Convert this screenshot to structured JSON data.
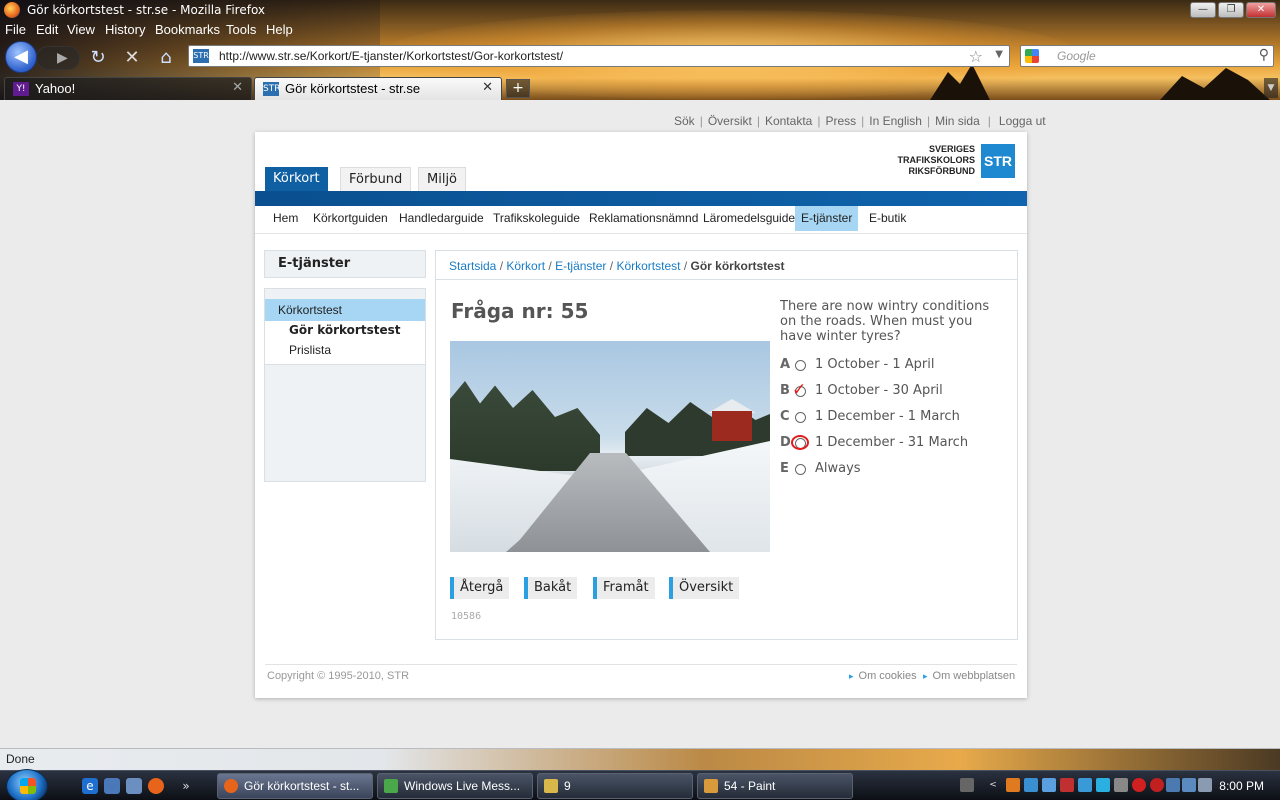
{
  "window": {
    "title": "Gör körkortstest - str.se - Mozilla Firefox",
    "controls": {
      "minimize": "—",
      "maximize": "❐",
      "close": "✕"
    }
  },
  "menu": [
    "File",
    "Edit",
    "View",
    "History",
    "Bookmarks",
    "Tools",
    "Help"
  ],
  "navbar": {
    "url": "http://www.str.se/Korkort/E-tjanster/Korkortstest/Gor-korkortstest/",
    "search_placeholder": "Google",
    "icons": {
      "back": "◀",
      "forward": "▶",
      "reload": "↻",
      "stop": "✕",
      "home": "⌂",
      "bookmark_star": "☆",
      "search_go": "⚲"
    }
  },
  "tabs": [
    {
      "label": "Yahoo!",
      "active": false,
      "favicon": "Y!",
      "color": "#5f1b8f"
    },
    {
      "label": "Gör körkortstest - str.se",
      "active": true,
      "favicon": "STR",
      "color": "#2b6fb0"
    }
  ],
  "site": {
    "utility_links": [
      "Sök",
      "Översikt",
      "Kontakta",
      "Press",
      "In English",
      "Min sida",
      "Logga ut"
    ],
    "logo": {
      "lines": [
        "SVERIGES",
        "TRAFIKSKOLORS",
        "RIKSFÖRBUND"
      ],
      "mark": "STR"
    },
    "main_tabs": [
      {
        "label": "Körkort",
        "active": true
      },
      {
        "label": "Förbund",
        "active": false
      },
      {
        "label": "Miljö",
        "active": false
      }
    ],
    "subnav": [
      {
        "label": "Hem",
        "active": false
      },
      {
        "label": "Körkortguiden",
        "active": false
      },
      {
        "label": "Handledarguide",
        "active": false
      },
      {
        "label": "Trafikskoleguide",
        "active": false
      },
      {
        "label": "Reklamationsnämnd",
        "active": false
      },
      {
        "label": "Läromedelsguide",
        "active": false
      },
      {
        "label": "E-tjänster",
        "active": true
      },
      {
        "label": "E-butik",
        "active": false
      }
    ],
    "sidebar": {
      "heading": "E-tjänster",
      "items": [
        {
          "label": "Körkortstest",
          "highlighted": true
        },
        {
          "label": "Gör körkortstest",
          "current": true
        },
        {
          "label": "Prislista"
        }
      ]
    },
    "breadcrumb": {
      "links": [
        "Startsida",
        "Körkort",
        "E-tjänster",
        "Körkortstest"
      ],
      "current": "Gör körkortstest",
      "separator": "/"
    },
    "quiz": {
      "title": "Fråga nr: 55",
      "question": "There are now wintry conditions on the roads. When must you have winter tyres?",
      "options": [
        {
          "letter": "A",
          "text": "1 October - 1 April",
          "mark": ""
        },
        {
          "letter": "B",
          "text": "1 October - 30 April",
          "mark": "check"
        },
        {
          "letter": "C",
          "text": "1 December - 1 March",
          "mark": ""
        },
        {
          "letter": "D",
          "text": "1 December - 31 March",
          "mark": "circle"
        },
        {
          "letter": "E",
          "text": "Always",
          "mark": ""
        }
      ],
      "buttons": [
        "Återgå",
        "Bakåt",
        "Framåt",
        "Översikt"
      ],
      "id": "10586"
    },
    "footer": {
      "copyright": "Copyright © 1995-2010, STR",
      "links": [
        "Om cookies",
        "Om webbplatsen"
      ]
    }
  },
  "statusbar": {
    "text": "Done"
  },
  "taskbar": {
    "buttons": [
      {
        "label": "Gör körkortstest - st...",
        "active": true,
        "icon_color": "#e8641b"
      },
      {
        "label": "Windows Live Mess...",
        "active": false,
        "icon_color": "#4aa84a"
      },
      {
        "label": "9",
        "active": false,
        "icon_color": "#d8b84a"
      },
      {
        "label": "54 - Paint",
        "active": false,
        "icon_color": "#d89a3a"
      }
    ],
    "clock": "8:00 PM",
    "quicklaunch_more": "»",
    "tray_expand": "<"
  }
}
